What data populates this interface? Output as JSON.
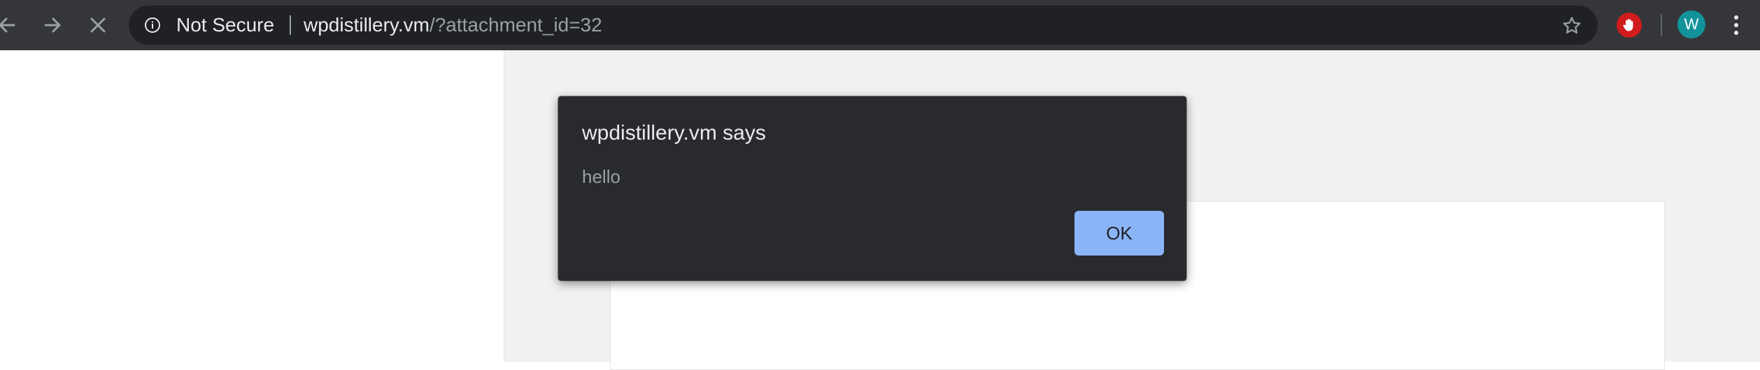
{
  "browser": {
    "security_label": "Not Secure",
    "url_host": "wpdistillery.vm",
    "url_path": "/?attachment_id=32",
    "profile_initial": "W",
    "icons": {
      "back": "arrow-left",
      "forward": "arrow-right",
      "stop": "close-x",
      "info": "info-circle",
      "bookmark": "star-outline",
      "extension": "adblock-hand",
      "menu": "three-dots-vertical"
    },
    "colors": {
      "toolbar": "#35363a",
      "omnibox": "#202124",
      "avatar": "#12939a",
      "extension": "#d01c1c"
    }
  },
  "dialog": {
    "title": "wpdistillery.vm says",
    "message": "hello",
    "ok_label": "OK",
    "colors": {
      "background": "#292a2d",
      "button": "#8ab4f8"
    }
  },
  "page": {
    "colors": {
      "background": "#ffffff",
      "gray_panel": "#f1f1f1"
    }
  }
}
